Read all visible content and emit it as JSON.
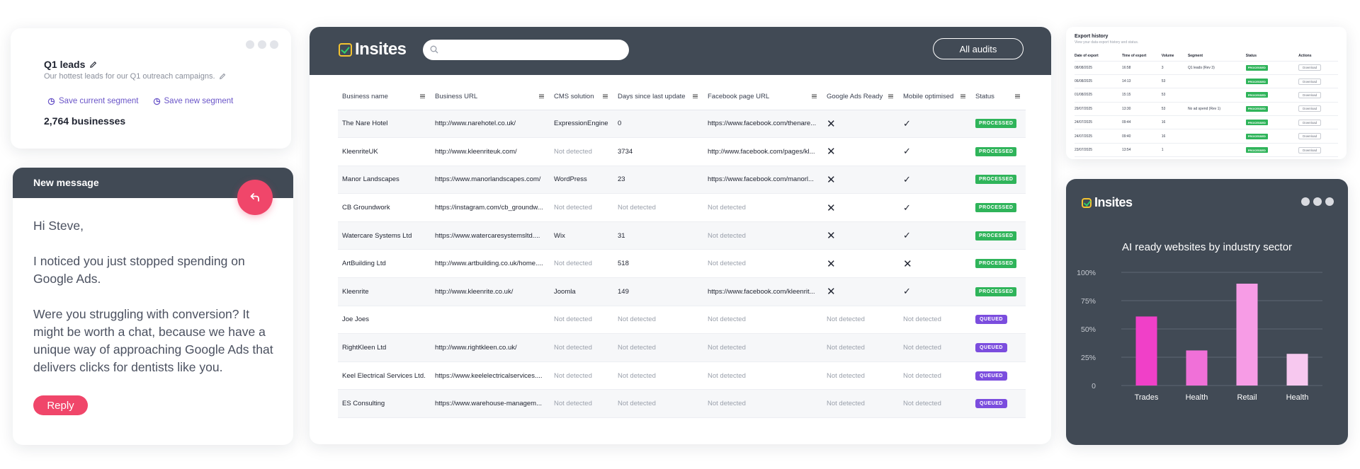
{
  "segment": {
    "title": "Q1 leads",
    "subtitle": "Our hottest leads for our Q1 outreach campaigns.",
    "save_current": "Save current segment",
    "save_new": "Save new segment",
    "count": "2,764 businesses"
  },
  "message": {
    "header": "New message",
    "greeting": "Hi Steve,",
    "para1": "I noticed you just stopped spending on Google Ads.",
    "para2": "Were you struggling with conversion? It might be worth a chat, because we have a unique way of approaching Google Ads that delivers clicks for dentists like you.",
    "reply_label": "Reply"
  },
  "main": {
    "logo": "Insites",
    "search_placeholder": "",
    "audits_label": "All audits",
    "columns": [
      "Business name",
      "Business URL",
      "CMS solution",
      "Days since last update",
      "Facebook page URL",
      "Google Ads Ready",
      "Mobile optimised",
      "Status"
    ],
    "rows": [
      {
        "name": "The Nare Hotel",
        "url": "http://www.narehotel.co.uk/",
        "cms": "ExpressionEngine",
        "days": "0",
        "facebook": "https://www.facebook.com/thenare...",
        "ads": "x",
        "mobile": "tick",
        "status": "PROCESSED"
      },
      {
        "name": "KleenriteUK",
        "url": "http://www.kleenriteuk.com/",
        "cms": "Not detected",
        "days": "3734",
        "facebook": "http://www.facebook.com/pages/kl...",
        "ads": "x",
        "mobile": "tick",
        "status": "PROCESSED"
      },
      {
        "name": "Manor Landscapes",
        "url": "https://www.manorlandscapes.com/",
        "cms": "WordPress",
        "days": "23",
        "facebook": "https://www.facebook.com/manorl...",
        "ads": "x",
        "mobile": "tick",
        "status": "PROCESSED"
      },
      {
        "name": "CB Groundwork",
        "url": "https://instagram.com/cb_groundw...",
        "cms": "Not detected",
        "days": "Not detected",
        "facebook": "Not detected",
        "ads": "x",
        "mobile": "tick",
        "status": "PROCESSED"
      },
      {
        "name": "Watercare Systems Ltd",
        "url": "https://www.watercaresystemsltd....",
        "cms": "Wix",
        "days": "31",
        "facebook": "Not detected",
        "ads": "x",
        "mobile": "tick",
        "status": "PROCESSED"
      },
      {
        "name": "ArtBuilding Ltd",
        "url": "http://www.artbuilding.co.uk/home....",
        "cms": "Not detected",
        "days": "518",
        "facebook": "Not detected",
        "ads": "x",
        "mobile": "x",
        "status": "PROCESSED"
      },
      {
        "name": "Kleenrite",
        "url": "http://www.kleenrite.co.uk/",
        "cms": "Joomla",
        "days": "149",
        "facebook": "https://www.facebook.com/kleenrit...",
        "ads": "x",
        "mobile": "tick",
        "status": "PROCESSED"
      },
      {
        "name": "Joe Joes",
        "url": "",
        "cms": "Not detected",
        "days": "Not detected",
        "facebook": "Not detected",
        "ads": "Not detected",
        "mobile": "Not detected",
        "status": "QUEUED"
      },
      {
        "name": "RightKleen Ltd",
        "url": "http://www.rightkleen.co.uk/",
        "cms": "Not detected",
        "days": "Not detected",
        "facebook": "Not detected",
        "ads": "Not detected",
        "mobile": "Not detected",
        "status": "QUEUED"
      },
      {
        "name": "Keel Electrical Services Ltd.",
        "url": "https://www.keelelectricalservices....",
        "cms": "Not detected",
        "days": "Not detected",
        "facebook": "Not detected",
        "ads": "Not detected",
        "mobile": "Not detected",
        "status": "QUEUED"
      },
      {
        "name": "ES Consulting",
        "url": "https://www.warehouse-managem...",
        "cms": "Not detected",
        "days": "Not detected",
        "facebook": "Not detected",
        "ads": "Not detected",
        "mobile": "Not detected",
        "status": "QUEUED"
      }
    ]
  },
  "export": {
    "title": "Export history",
    "subtitle": "View your data export history and status.",
    "columns": [
      "Date of export",
      "Time of export",
      "Volume",
      "Segment",
      "Status",
      "Actions"
    ],
    "rows": [
      {
        "date": "08/08/2025",
        "time": "16:58",
        "volume": "3",
        "segment": "Q1 leads (Rev 3)",
        "status": "PROCESSED",
        "action": "Download"
      },
      {
        "date": "06/08/2025",
        "time": "14:13",
        "volume": "53",
        "segment": "",
        "status": "PROCESSED",
        "action": "Download"
      },
      {
        "date": "01/08/2025",
        "time": "15:15",
        "volume": "53",
        "segment": "",
        "status": "PROCESSED",
        "action": "Download"
      },
      {
        "date": "29/07/2025",
        "time": "13:30",
        "volume": "53",
        "segment": "No ad spend (Rev 1)",
        "status": "PROCESSED",
        "action": "Download"
      },
      {
        "date": "24/07/2025",
        "time": "09:44",
        "volume": "16",
        "segment": "",
        "status": "PROCESSED",
        "action": "Download"
      },
      {
        "date": "24/07/2025",
        "time": "09:40",
        "volume": "16",
        "segment": "",
        "status": "PROCESSED",
        "action": "Download"
      },
      {
        "date": "23/07/2025",
        "time": "13:54",
        "volume": "1",
        "segment": "",
        "status": "PROCESSED",
        "action": "Download"
      }
    ]
  },
  "chart_card": {
    "logo": "Insites"
  },
  "chart_data": {
    "type": "bar",
    "title": "AI ready websites by industry sector",
    "categories": [
      "Trades",
      "Health",
      "Retail",
      "Health"
    ],
    "values": [
      61,
      31,
      90,
      28
    ],
    "ylim": [
      0,
      100
    ],
    "yticks": [
      "0",
      "25%",
      "50%",
      "75%",
      "100%"
    ],
    "grid": true,
    "colors": [
      "#f040c8",
      "#f070d8",
      "#f79ce6",
      "#f7c8ef"
    ]
  },
  "colors": {
    "header_bg": "#414a55",
    "accent_pink": "#f0466a",
    "processed": "#2fb45a",
    "queued": "#7b4dde",
    "link_purple": "#6a55c8"
  }
}
